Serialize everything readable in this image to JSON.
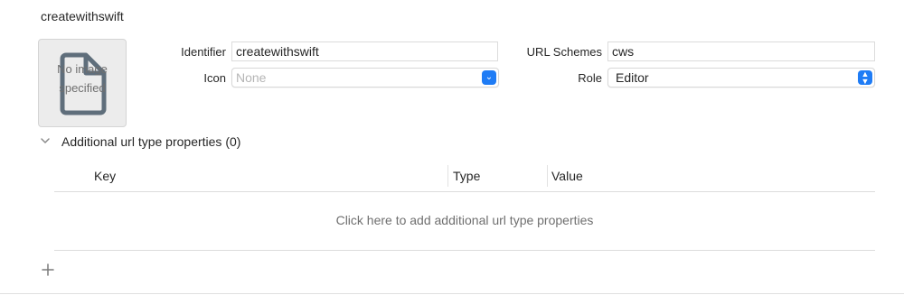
{
  "section_title": "createwithswift",
  "image_well": {
    "placeholder": "No image specified"
  },
  "identifier": {
    "label": "Identifier",
    "value": "createwithswift"
  },
  "icon": {
    "label": "Icon",
    "value": "None"
  },
  "url_schemes": {
    "label": "URL Schemes",
    "value": "cws"
  },
  "role": {
    "label": "Role",
    "value": "Editor"
  },
  "additional": {
    "title": "Additional url type properties (0)",
    "columns": [
      "Key",
      "Type",
      "Value"
    ],
    "empty_hint": "Click here to add additional url type properties"
  },
  "colors": {
    "accent": "#1f7cf5"
  }
}
